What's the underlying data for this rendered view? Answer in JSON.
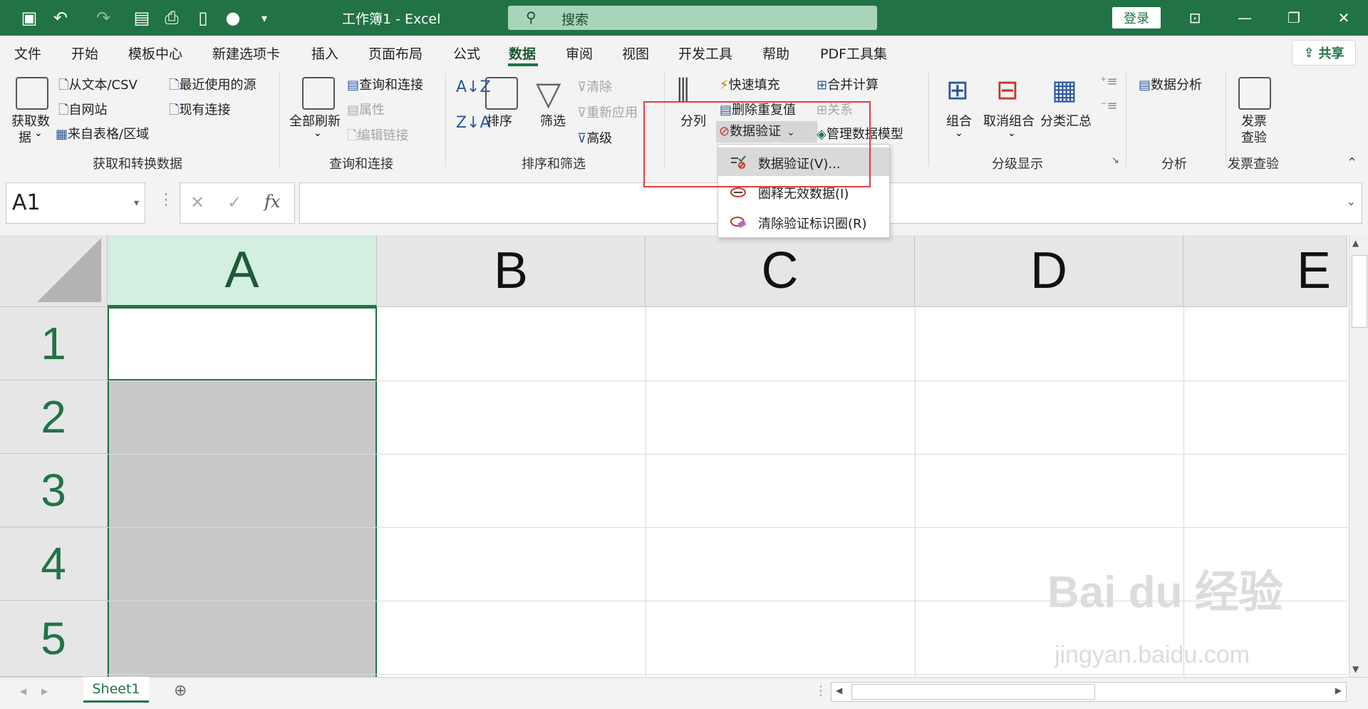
{
  "titlebar": {
    "doc_title": "工作簿1 - Excel",
    "search_placeholder": "搜索",
    "login_label": "登录"
  },
  "tabs": [
    "文件",
    "开始",
    "模板中心",
    "新建选项卡",
    "插入",
    "页面布局",
    "公式",
    "数据",
    "审阅",
    "视图",
    "开发工具",
    "帮助",
    "PDF工具集"
  ],
  "active_tab": "数据",
  "share_label": "共享",
  "ribbon": {
    "get_data": "获取数",
    "get_data2": "据",
    "from_text": "从文本/CSV",
    "from_web": "自网站",
    "from_table": "来自表格/区域",
    "recent_sources": "最近使用的源",
    "existing_conn": "现有连接",
    "group_get": "获取和转换数据",
    "refresh_all": "全部刷新",
    "queries_conn": "查询和连接",
    "properties": "属性",
    "edit_links": "编辑链接",
    "group_query": "查询和连接",
    "sort": "排序",
    "filter": "筛选",
    "clear": "清除",
    "reapply": "重新应用",
    "advanced": "高级",
    "group_sort": "排序和筛选",
    "text_to_col": "分列",
    "flash_fill": "快速填充",
    "remove_dup": "删除重复值",
    "data_validation": "数据验证",
    "consolidate": "合并计算",
    "relations": "关系",
    "manage_model": "管理数据模型",
    "group": "组合",
    "ungroup": "取消组合",
    "subtotal": "分类汇总",
    "group_outline": "分级显示",
    "data_analysis": "数据分析",
    "group_analysis": "分析",
    "invoice": "发票",
    "invoice2": "查验",
    "group_invoice": "发票查验"
  },
  "dropdown": {
    "item1": "数据验证(V)...",
    "item2": "圈释无效数据(I)",
    "item3": "清除验证标识圈(R)"
  },
  "formula_bar": {
    "name_box": "A1",
    "fx": "fx",
    "cancel": "✕",
    "confirm": "✓"
  },
  "grid": {
    "columns": [
      "A",
      "B",
      "C",
      "D",
      "E"
    ],
    "rows": [
      "1",
      "2",
      "3",
      "4",
      "5"
    ]
  },
  "sheet_tab": "Sheet1",
  "watermark": "Bai du 经验",
  "watermark_sub": "jingyan.baidu.com"
}
